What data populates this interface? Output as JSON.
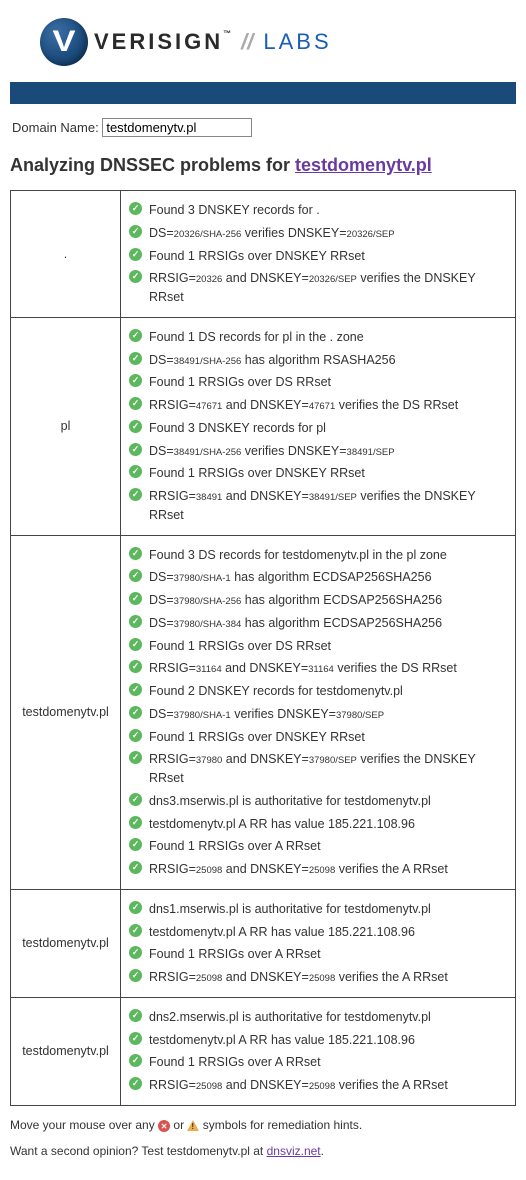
{
  "logo": {
    "brand": "VERISIGN",
    "tm": "™",
    "slashes": "//",
    "labs": "LABS"
  },
  "form": {
    "label": "Domain Name:",
    "value": "testdomenytv.pl"
  },
  "heading": {
    "prefix": "Analyzing DNSSEC problems for ",
    "domain": "testdomenytv.pl"
  },
  "rows": [
    {
      "zone": ".",
      "checks": [
        {
          "status": "ok",
          "segs": [
            {
              "t": "Found 3 DNSKEY records for ."
            }
          ]
        },
        {
          "status": "ok",
          "segs": [
            {
              "t": "DS="
            },
            {
              "t": "20326/SHA-256",
              "small": true
            },
            {
              "t": " verifies DNSKEY="
            },
            {
              "t": "20326/SEP",
              "small": true
            }
          ]
        },
        {
          "status": "ok",
          "segs": [
            {
              "t": "Found 1 RRSIGs over DNSKEY RRset"
            }
          ]
        },
        {
          "status": "ok",
          "segs": [
            {
              "t": "RRSIG="
            },
            {
              "t": "20326",
              "small": true
            },
            {
              "t": " and DNSKEY="
            },
            {
              "t": "20326/SEP",
              "small": true
            },
            {
              "t": " verifies the DNSKEY RRset"
            }
          ]
        }
      ]
    },
    {
      "zone": "pl",
      "checks": [
        {
          "status": "ok",
          "segs": [
            {
              "t": "Found 1 DS records for pl in the . zone"
            }
          ]
        },
        {
          "status": "ok",
          "segs": [
            {
              "t": "DS="
            },
            {
              "t": "38491/SHA-256",
              "small": true
            },
            {
              "t": " has algorithm RSASHA256"
            }
          ]
        },
        {
          "status": "ok",
          "segs": [
            {
              "t": "Found 1 RRSIGs over DS RRset"
            }
          ]
        },
        {
          "status": "ok",
          "segs": [
            {
              "t": "RRSIG="
            },
            {
              "t": "47671",
              "small": true
            },
            {
              "t": " and DNSKEY="
            },
            {
              "t": "47671",
              "small": true
            },
            {
              "t": " verifies the DS RRset"
            }
          ]
        },
        {
          "status": "ok",
          "segs": [
            {
              "t": "Found 3 DNSKEY records for pl"
            }
          ]
        },
        {
          "status": "ok",
          "segs": [
            {
              "t": "DS="
            },
            {
              "t": "38491/SHA-256",
              "small": true
            },
            {
              "t": " verifies DNSKEY="
            },
            {
              "t": "38491/SEP",
              "small": true
            }
          ]
        },
        {
          "status": "ok",
          "segs": [
            {
              "t": "Found 1 RRSIGs over DNSKEY RRset"
            }
          ]
        },
        {
          "status": "ok",
          "segs": [
            {
              "t": "RRSIG="
            },
            {
              "t": "38491",
              "small": true
            },
            {
              "t": " and DNSKEY="
            },
            {
              "t": "38491/SEP",
              "small": true
            },
            {
              "t": " verifies the DNSKEY RRset"
            }
          ]
        }
      ]
    },
    {
      "zone": "testdomenytv.pl",
      "checks": [
        {
          "status": "ok",
          "segs": [
            {
              "t": "Found 3 DS records for testdomenytv.pl in the pl zone"
            }
          ]
        },
        {
          "status": "ok",
          "segs": [
            {
              "t": "DS="
            },
            {
              "t": "37980/SHA-1",
              "small": true
            },
            {
              "t": " has algorithm ECDSAP256SHA256"
            }
          ]
        },
        {
          "status": "ok",
          "segs": [
            {
              "t": "DS="
            },
            {
              "t": "37980/SHA-256",
              "small": true
            },
            {
              "t": " has algorithm ECDSAP256SHA256"
            }
          ]
        },
        {
          "status": "ok",
          "segs": [
            {
              "t": "DS="
            },
            {
              "t": "37980/SHA-384",
              "small": true
            },
            {
              "t": " has algorithm ECDSAP256SHA256"
            }
          ]
        },
        {
          "status": "ok",
          "segs": [
            {
              "t": "Found 1 RRSIGs over DS RRset"
            }
          ]
        },
        {
          "status": "ok",
          "segs": [
            {
              "t": "RRSIG="
            },
            {
              "t": "31164",
              "small": true
            },
            {
              "t": " and DNSKEY="
            },
            {
              "t": "31164",
              "small": true
            },
            {
              "t": " verifies the DS RRset"
            }
          ]
        },
        {
          "status": "ok",
          "segs": [
            {
              "t": "Found 2 DNSKEY records for testdomenytv.pl"
            }
          ]
        },
        {
          "status": "ok",
          "segs": [
            {
              "t": "DS="
            },
            {
              "t": "37980/SHA-1",
              "small": true
            },
            {
              "t": " verifies DNSKEY="
            },
            {
              "t": "37980/SEP",
              "small": true
            }
          ]
        },
        {
          "status": "ok",
          "segs": [
            {
              "t": "Found 1 RRSIGs over DNSKEY RRset"
            }
          ]
        },
        {
          "status": "ok",
          "segs": [
            {
              "t": "RRSIG="
            },
            {
              "t": "37980",
              "small": true
            },
            {
              "t": " and DNSKEY="
            },
            {
              "t": "37980/SEP",
              "small": true
            },
            {
              "t": " verifies the DNSKEY RRset"
            }
          ]
        },
        {
          "status": "ok",
          "segs": [
            {
              "t": "dns3.mserwis.pl is authoritative for testdomenytv.pl"
            }
          ]
        },
        {
          "status": "ok",
          "segs": [
            {
              "t": "testdomenytv.pl A RR has value 185.221.108.96"
            }
          ]
        },
        {
          "status": "ok",
          "segs": [
            {
              "t": "Found 1 RRSIGs over A RRset"
            }
          ]
        },
        {
          "status": "ok",
          "segs": [
            {
              "t": "RRSIG="
            },
            {
              "t": "25098",
              "small": true
            },
            {
              "t": " and DNSKEY="
            },
            {
              "t": "25098",
              "small": true
            },
            {
              "t": " verifies the A RRset"
            }
          ]
        }
      ]
    },
    {
      "zone": "testdomenytv.pl",
      "checks": [
        {
          "status": "ok",
          "segs": [
            {
              "t": "dns1.mserwis.pl is authoritative for testdomenytv.pl"
            }
          ]
        },
        {
          "status": "ok",
          "segs": [
            {
              "t": "testdomenytv.pl A RR has value 185.221.108.96"
            }
          ]
        },
        {
          "status": "ok",
          "segs": [
            {
              "t": "Found 1 RRSIGs over A RRset"
            }
          ]
        },
        {
          "status": "ok",
          "segs": [
            {
              "t": "RRSIG="
            },
            {
              "t": "25098",
              "small": true
            },
            {
              "t": " and DNSKEY="
            },
            {
              "t": "25098",
              "small": true
            },
            {
              "t": " verifies the A RRset"
            }
          ]
        }
      ]
    },
    {
      "zone": "testdomenytv.pl",
      "checks": [
        {
          "status": "ok",
          "segs": [
            {
              "t": "dns2.mserwis.pl is authoritative for testdomenytv.pl"
            }
          ]
        },
        {
          "status": "ok",
          "segs": [
            {
              "t": "testdomenytv.pl A RR has value 185.221.108.96"
            }
          ]
        },
        {
          "status": "ok",
          "segs": [
            {
              "t": "Found 1 RRSIGs over A RRset"
            }
          ]
        },
        {
          "status": "ok",
          "segs": [
            {
              "t": "RRSIG="
            },
            {
              "t": "25098",
              "small": true
            },
            {
              "t": " and DNSKEY="
            },
            {
              "t": "25098",
              "small": true
            },
            {
              "t": " verifies the A RRset"
            }
          ]
        }
      ]
    }
  ],
  "footer": {
    "hints_pre": "Move your mouse over any ",
    "hints_mid": " or ",
    "hints_post": " symbols for remediation hints.",
    "second_pre": "Want a second opinion? Test testdomenytv.pl at ",
    "second_link": "dnsviz.net",
    "second_post": "."
  }
}
